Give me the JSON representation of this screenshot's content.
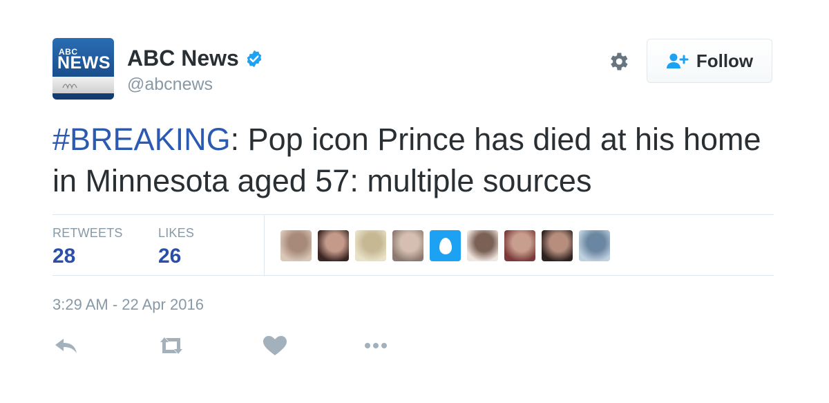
{
  "account": {
    "avatar_text_small": "ABC",
    "avatar_text_big": "NEWS",
    "display_name": "ABC News",
    "screen_name": "@abcnews",
    "verified": true
  },
  "actions_header": {
    "follow_label": "Follow",
    "settings_icon": "gear-icon",
    "follow_icon": "person-add-icon"
  },
  "tweet": {
    "hashtag": "#BREAKING",
    "text_after_hashtag": ": Pop icon Prince has died at his home in Minnesota aged 57: multiple sources"
  },
  "stats": {
    "retweets_label": "RETWEETS",
    "retweets_count": "28",
    "likes_label": "LIKES",
    "likes_count": "26"
  },
  "likers": [
    {
      "kind": "photo",
      "colors": [
        "#d9c7b8",
        "#a88a7a"
      ]
    },
    {
      "kind": "photo",
      "colors": [
        "#3a2522",
        "#c49a8a"
      ]
    },
    {
      "kind": "photo",
      "colors": [
        "#e9e2c8",
        "#c7b894"
      ]
    },
    {
      "kind": "photo",
      "colors": [
        "#8c7a72",
        "#d6bfb1"
      ]
    },
    {
      "kind": "egg",
      "colors": [
        "#1da1f2",
        "#ffffff"
      ]
    },
    {
      "kind": "photo",
      "colors": [
        "#efe6df",
        "#7b6055"
      ]
    },
    {
      "kind": "photo",
      "colors": [
        "#7a3a3a",
        "#c89f8e"
      ]
    },
    {
      "kind": "photo",
      "colors": [
        "#2d2220",
        "#b78e7e"
      ]
    },
    {
      "kind": "photo",
      "colors": [
        "#bfd0df",
        "#6a86a1"
      ]
    }
  ],
  "timestamp": "3:29 AM - 22 Apr 2016",
  "action_icons": [
    "reply-icon",
    "retweet-icon",
    "heart-icon",
    "more-icon"
  ],
  "colors": {
    "link": "#2b5ab0",
    "stat_value": "#2b4ea8",
    "muted": "#8899a6",
    "verified": "#1da1f2"
  }
}
